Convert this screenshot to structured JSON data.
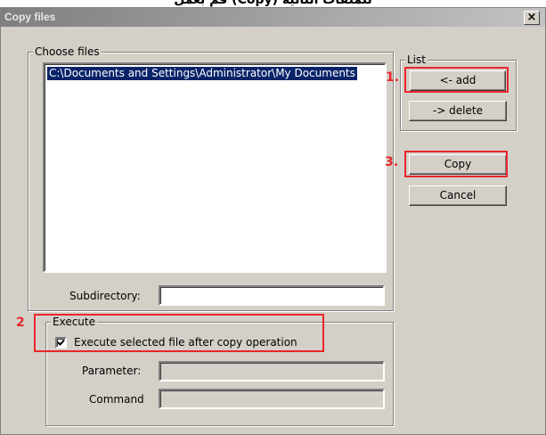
{
  "top_caption": "قم بعمل (Copy) للملفات التالية",
  "window": {
    "title": "Copy files",
    "close_label": "×"
  },
  "choose_files": {
    "legend": "Choose files",
    "items": [
      "C:\\Documents and Settings\\Administrator\\My Documents"
    ]
  },
  "list_group": {
    "legend": "List",
    "add_label": "<- add",
    "delete_label": "-> delete"
  },
  "buttons": {
    "copy_label": "Copy",
    "cancel_label": "Cancel"
  },
  "subdirectory": {
    "label": "Subdirectory:",
    "value": ""
  },
  "execute": {
    "legend": "Execute",
    "checkbox_label": "Execute selected file after copy operation",
    "checked": true,
    "parameter_label": "Parameter:",
    "parameter_value": "",
    "command_label": "Command",
    "command_value": ""
  },
  "annotations": {
    "step1": "1.",
    "step2": "2",
    "step3": "3.",
    "highlight_color": "#e8262c"
  }
}
